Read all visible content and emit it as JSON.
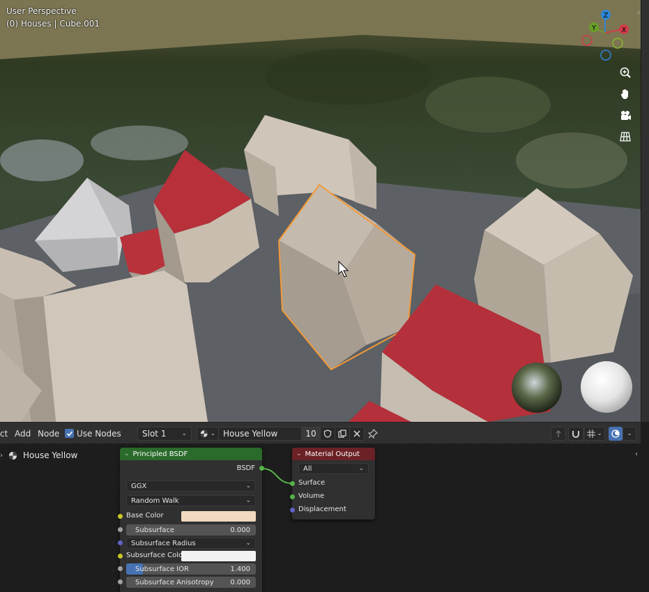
{
  "viewport": {
    "title": "User Perspective",
    "subtitle": "(0) Houses | Cube.001",
    "gizmo": {
      "z": "Z",
      "y": "Y",
      "x": "X"
    }
  },
  "header": {
    "menu": [
      {
        "label": "ct"
      },
      {
        "label": "Add"
      },
      {
        "label": "Node"
      }
    ],
    "use_nodes": {
      "label": "Use Nodes",
      "checked": true
    },
    "slot": "Slot 1",
    "material_name": "House Yellow",
    "user_count": "10"
  },
  "outline": {
    "item": "House Yellow"
  },
  "bsdf_node": {
    "title": "Principled BSDF",
    "output": "BSDF",
    "distribution": "GGX",
    "subsurface_method": "Random Walk",
    "rows": [
      {
        "label": "Base Color"
      },
      {
        "label": "Subsurface",
        "value": "0.000"
      },
      {
        "label": "Subsurface Radius"
      },
      {
        "label": "Subsurface Color"
      },
      {
        "label": "Subsurface IOR",
        "value": "1.400"
      },
      {
        "label": "Subsurface Anisotropy",
        "value": "0.000"
      }
    ],
    "base_color": "#f0d9be",
    "subsurface_color": "#f2f2f2"
  },
  "output_node": {
    "title": "Material Output",
    "target": "All",
    "inputs": [
      "Surface",
      "Volume",
      "Displacement"
    ]
  },
  "colors": {
    "bsdf_header": "#2a6a2a",
    "output_header": "#6b2125",
    "selection": "#f29a3a",
    "accent": "#4772b3"
  }
}
